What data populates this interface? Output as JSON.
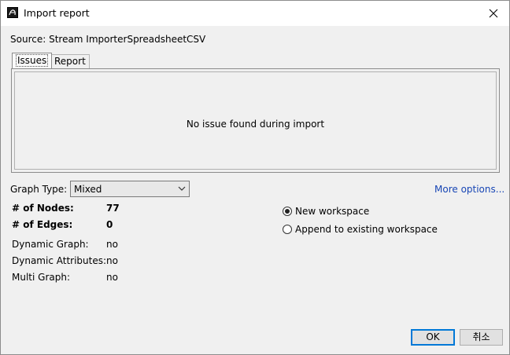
{
  "window": {
    "title": "Import report",
    "icon": "app-logo-icon"
  },
  "source": {
    "text": "Source: Stream ImporterSpreadsheetCSV"
  },
  "tabs": [
    {
      "label": "Issues",
      "selected": true
    },
    {
      "label": "Report",
      "selected": false
    }
  ],
  "issues": {
    "message": "No issue found during import"
  },
  "graph_type": {
    "label": "Graph Type:",
    "value": "Mixed"
  },
  "more_options": {
    "label": "More options..."
  },
  "stats": {
    "nodes_label": "# of Nodes:",
    "nodes_value": "77",
    "edges_label": "# of Edges:",
    "edges_value": "0",
    "dynamic_graph_label": "Dynamic Graph:",
    "dynamic_graph_value": "no",
    "dynamic_attributes_label": "Dynamic Attributes:",
    "dynamic_attributes_value": "no",
    "multi_graph_label": "Multi Graph:",
    "multi_graph_value": "no"
  },
  "workspace": {
    "new_label": "New workspace",
    "new_selected": true,
    "append_label": "Append to existing workspace",
    "append_selected": false
  },
  "buttons": {
    "ok": "OK",
    "cancel": "취소"
  },
  "colors": {
    "link": "#1846b5",
    "focus_border": "#0078d7",
    "background": "#f0f0f0"
  }
}
